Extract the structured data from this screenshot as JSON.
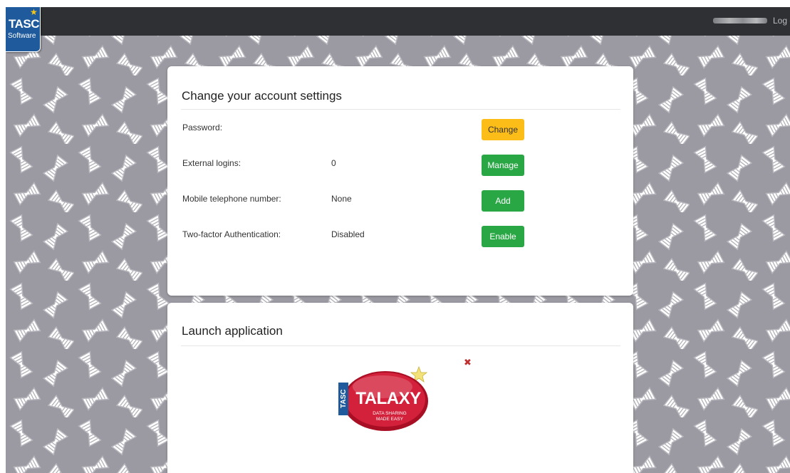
{
  "navbar": {
    "logo_text": "TASC",
    "logo_subtext": "Software",
    "logout_label": "Log out"
  },
  "settings": {
    "title": "Change your account settings",
    "rows": [
      {
        "label": "Password:",
        "value": "",
        "button": "Change",
        "button_style": "warning"
      },
      {
        "label": "External logins:",
        "value": "0",
        "button": "Manage",
        "button_style": "success"
      },
      {
        "label": "Mobile telephone number:",
        "value": "None",
        "button": "Add",
        "button_style": "success"
      },
      {
        "label": "Two-factor Authentication:",
        "value": "Disabled",
        "button": "Enable",
        "button_style": "success"
      }
    ]
  },
  "launch": {
    "title": "Launch application",
    "app_logo": {
      "side_text": "TASC",
      "main_text": "TALAXY",
      "tagline_1": "DATA SHARING",
      "tagline_2": "MADE EASY"
    },
    "remove_icon": "close-icon"
  },
  "colors": {
    "navbar": "#2e3033",
    "background": "#9b9aa2",
    "warning_button": "#fdbd18",
    "success_button": "#29a745",
    "logo_blue": "#1e5a9c",
    "talaxy_red": "#c8102e"
  }
}
